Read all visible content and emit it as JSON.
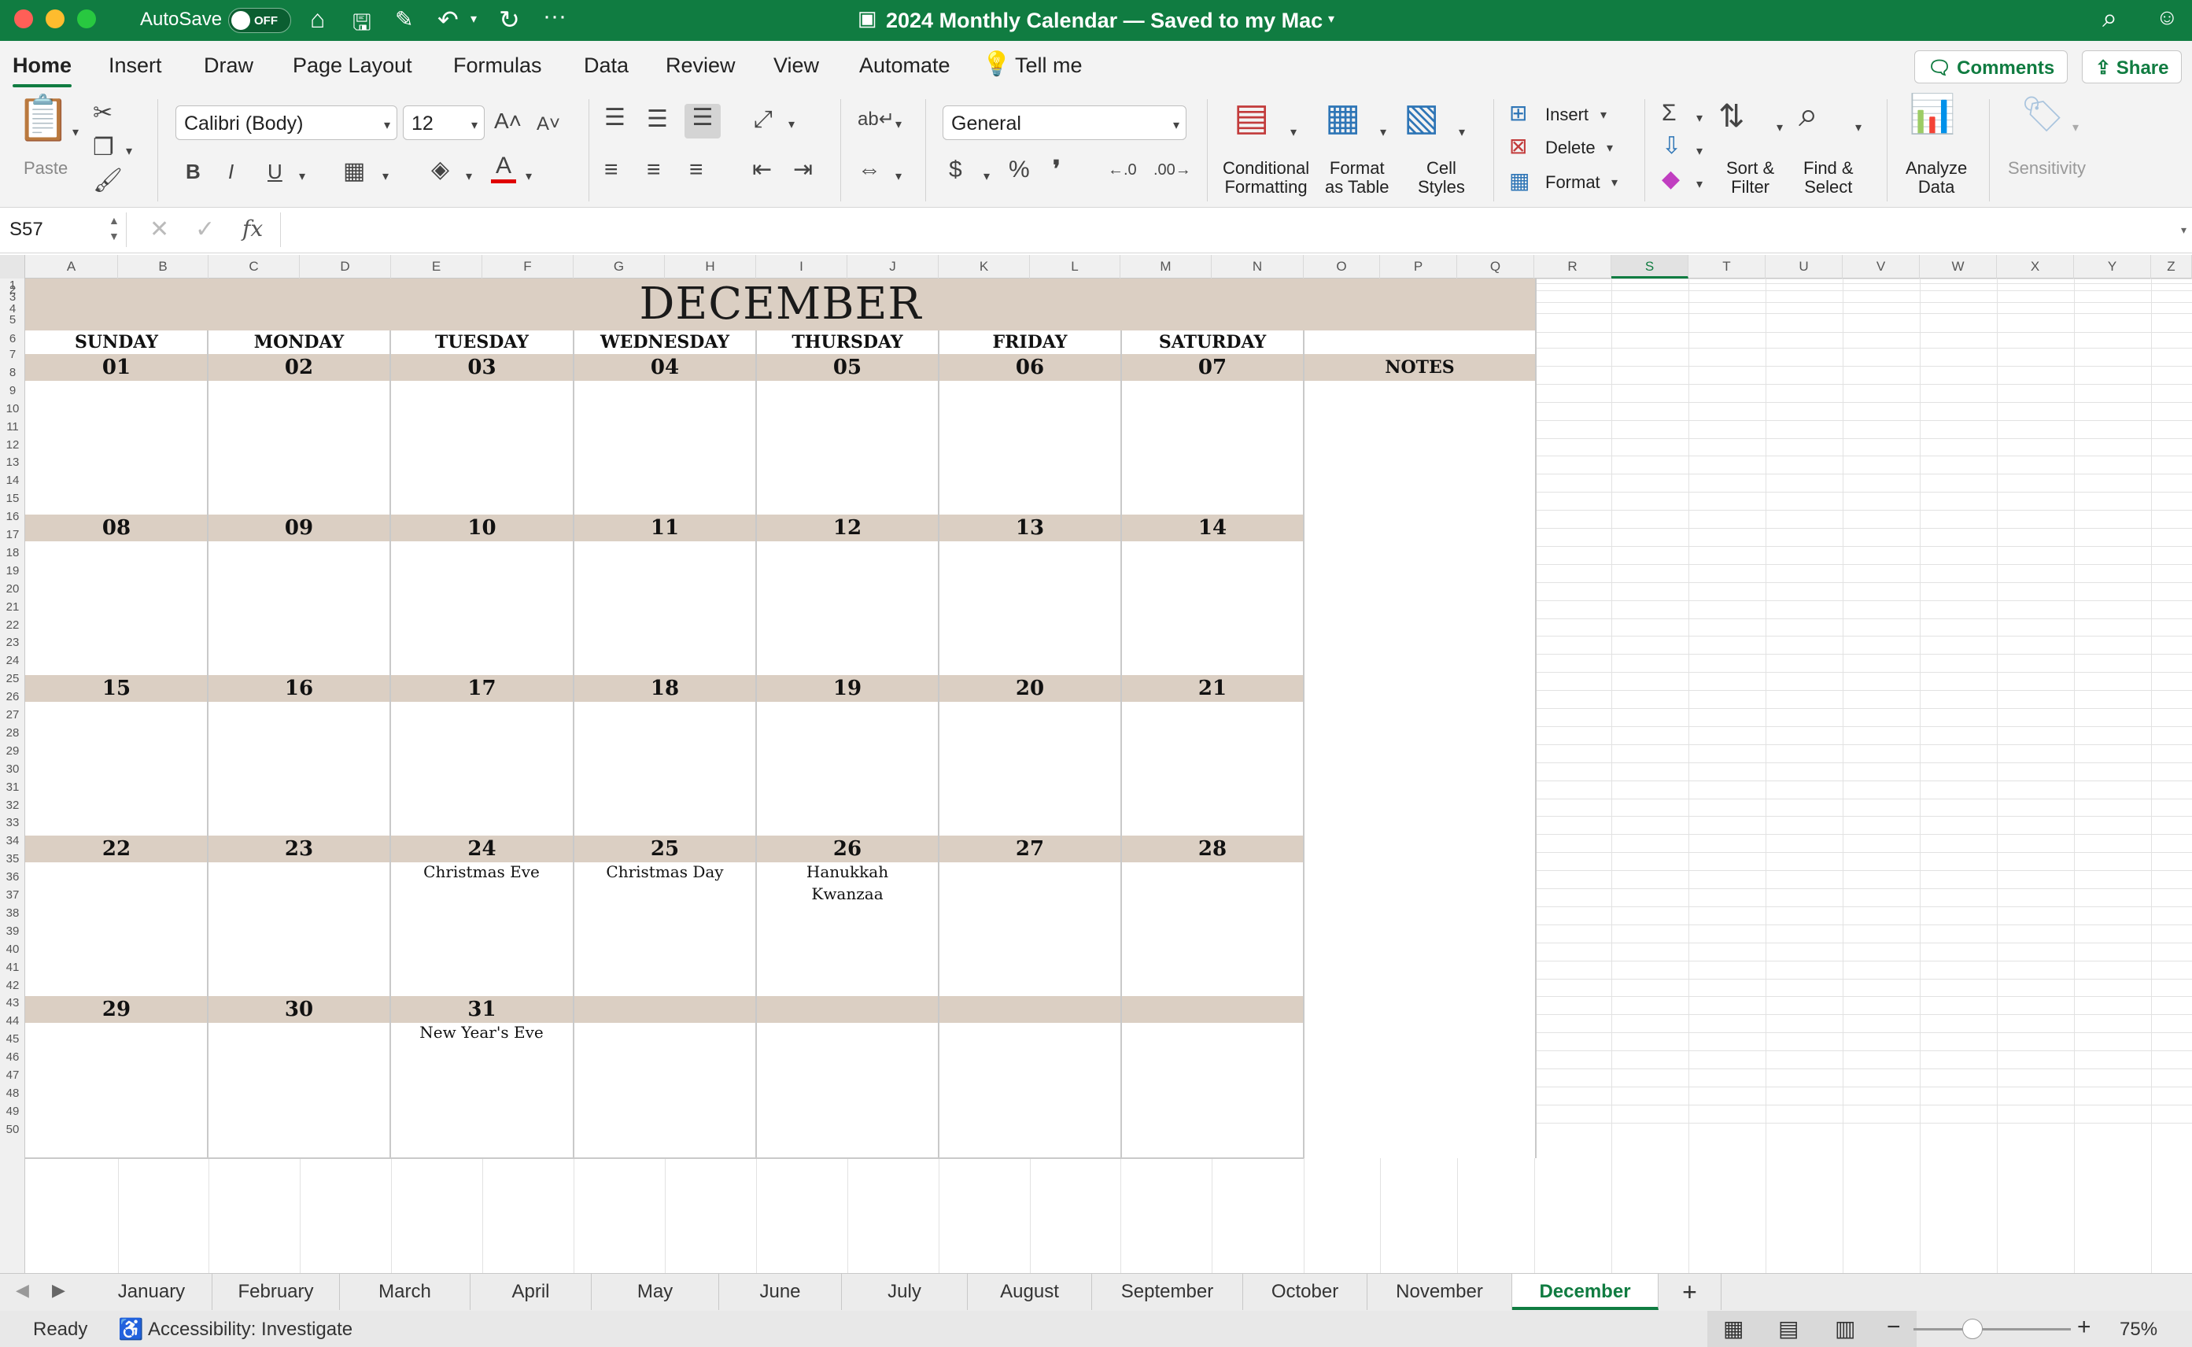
{
  "window": {
    "autosave_label": "AutoSave",
    "autosave_state": "OFF",
    "title": "2024 Monthly Calendar — Saved to my Mac"
  },
  "ribbon_tabs": [
    "Home",
    "Insert",
    "Draw",
    "Page Layout",
    "Formulas",
    "Data",
    "Review",
    "View",
    "Automate"
  ],
  "tell_me": "Tell me",
  "comments_label": "Comments",
  "share_label": "Share",
  "ribbon": {
    "paste": "Paste",
    "font_name": "Calibri (Body)",
    "font_size": "12",
    "number_format": "General",
    "cond_fmt": [
      "Conditional",
      "Formatting"
    ],
    "fmt_table": [
      "Format",
      "as Table"
    ],
    "cell_styles": [
      "Cell",
      "Styles"
    ],
    "insert": "Insert",
    "delete": "Delete",
    "format": "Format",
    "sort": [
      "Sort &",
      "Filter"
    ],
    "find": [
      "Find &",
      "Select"
    ],
    "analyze": [
      "Analyze",
      "Data"
    ],
    "sensitivity": "Sensitivity"
  },
  "formula_bar": {
    "name_box": "S57",
    "fx": "fx",
    "content": ""
  },
  "columns": [
    "A",
    "B",
    "C",
    "D",
    "E",
    "F",
    "G",
    "H",
    "I",
    "J",
    "K",
    "L",
    "M",
    "N",
    "O",
    "P",
    "Q",
    "R",
    "S",
    "T",
    "U",
    "V",
    "W",
    "X",
    "Y",
    "Z"
  ],
  "selected_column": "S",
  "rows": [
    "1",
    "2",
    "3",
    "4",
    "5",
    "6",
    "7",
    "8",
    "9",
    "10",
    "11",
    "12",
    "13",
    "14",
    "15",
    "16",
    "17",
    "18",
    "19",
    "20",
    "21",
    "22",
    "23",
    "24",
    "25",
    "26",
    "27",
    "28",
    "29",
    "30",
    "31",
    "32",
    "33",
    "34",
    "35",
    "36",
    "37",
    "38",
    "39",
    "40",
    "41",
    "42",
    "43",
    "44",
    "45",
    "46",
    "47",
    "48",
    "49",
    "50"
  ],
  "calendar": {
    "month": "DECEMBER",
    "days": [
      "SUNDAY",
      "MONDAY",
      "TUESDAY",
      "WEDNESDAY",
      "THURSDAY",
      "FRIDAY",
      "SATURDAY"
    ],
    "notes_label": "NOTES",
    "weeks": [
      [
        "01",
        "02",
        "03",
        "04",
        "05",
        "06",
        "07"
      ],
      [
        "08",
        "09",
        "10",
        "11",
        "12",
        "13",
        "14"
      ],
      [
        "15",
        "16",
        "17",
        "18",
        "19",
        "20",
        "21"
      ],
      [
        "22",
        "23",
        "24",
        "25",
        "26",
        "27",
        "28"
      ],
      [
        "29",
        "30",
        "31",
        "",
        "",
        "",
        ""
      ]
    ],
    "events": {
      "christmas_eve": "Christmas Eve",
      "christmas_day": "Christmas Day",
      "hanukkah": "Hanukkah",
      "kwanzaa": "Kwanzaa",
      "new_years_eve": "New Year's Eve"
    }
  },
  "sheet_tabs": [
    "January",
    "February",
    "March",
    "April",
    "May",
    "June",
    "July",
    "August",
    "September",
    "October",
    "November",
    "December"
  ],
  "active_sheet": "December",
  "status": {
    "ready": "Ready",
    "accessibility": "Accessibility: Investigate",
    "zoom": "75%"
  },
  "colors": {
    "accent": "#107c41",
    "band": "#dbcfc3"
  }
}
